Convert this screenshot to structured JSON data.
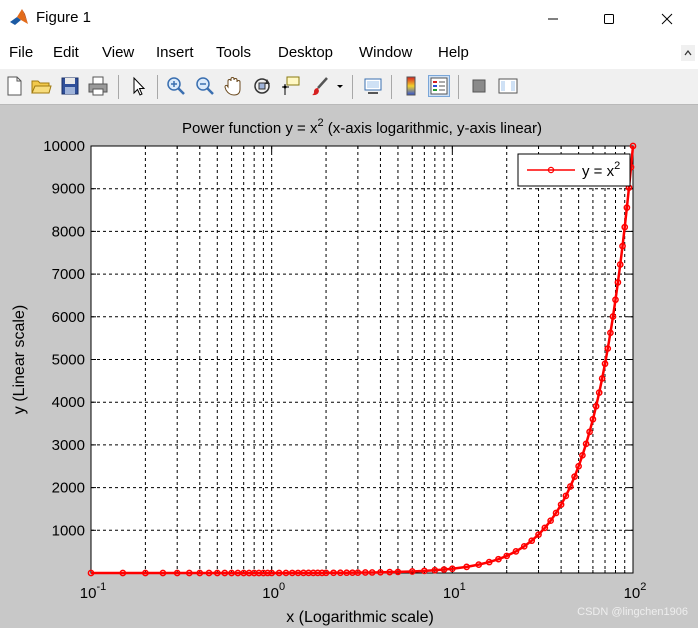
{
  "window": {
    "title": "Figure 1",
    "controls": {
      "minimize": "minimize",
      "maximize": "maximize",
      "close": "close"
    }
  },
  "menu": {
    "items": [
      "File",
      "Edit",
      "View",
      "Insert",
      "Tools",
      "Desktop",
      "Window",
      "Help"
    ]
  },
  "toolbar": {
    "buttons": [
      "new-figure",
      "open-file",
      "save-figure",
      "print-figure",
      "edit-plot",
      "zoom-in",
      "zoom-out",
      "pan",
      "rotate-3d",
      "data-cursor",
      "brush",
      "link-plot",
      "insert-colorbar",
      "insert-legend",
      "hide-plot-tools",
      "show-plot-tools"
    ]
  },
  "colors": {
    "line": "#ff0000",
    "axes_bg": "#ffffff",
    "figure_bg": "#c8c8c8",
    "grid": "#000000"
  },
  "watermark": "CSDN @lingchen1906",
  "chart_data": {
    "type": "line",
    "title": "Power function y = x",
    "title_superscript": "2",
    "title_rest": "  (x-axis logarithmic, y-axis linear)",
    "xlabel": "x (Logarithmic scale)",
    "ylabel": "y (Linear scale)",
    "xscale": "log",
    "yscale": "linear",
    "xlim": [
      0.1,
      100
    ],
    "ylim": [
      0,
      10000
    ],
    "xticks": [
      {
        "value": 0.1,
        "base": "10",
        "exp": "-1"
      },
      {
        "value": 1,
        "base": "10",
        "exp": "0"
      },
      {
        "value": 10,
        "base": "10",
        "exp": "1"
      },
      {
        "value": 100,
        "base": "10",
        "exp": "2"
      }
    ],
    "yticks": [
      1000,
      2000,
      3000,
      4000,
      5000,
      6000,
      7000,
      8000,
      9000,
      10000
    ],
    "ytick_labels": [
      "1000",
      "2000",
      "3000",
      "4000",
      "5000",
      "6000",
      "7000",
      "8000",
      "9000",
      "10000"
    ],
    "grid": true,
    "grid_style": "dashed",
    "legend_position": "top-right",
    "series": [
      {
        "name": "y = x",
        "name_superscript": "2",
        "color": "#ff0000",
        "marker": "circle",
        "formula": "y = x^2",
        "x": [
          0.1,
          0.15,
          0.2,
          0.25,
          0.3,
          0.35,
          0.4,
          0.45,
          0.5,
          0.55,
          0.6,
          0.65,
          0.7,
          0.75,
          0.8,
          0.85,
          0.9,
          0.95,
          1,
          1.1,
          1.2,
          1.3,
          1.4,
          1.5,
          1.6,
          1.7,
          1.8,
          1.9,
          2,
          2.2,
          2.4,
          2.6,
          2.8,
          3,
          3.3,
          3.6,
          4,
          4.5,
          5,
          6,
          7,
          8,
          9,
          10,
          12,
          14,
          16,
          18,
          20,
          22.5,
          25,
          27.5,
          30,
          32.5,
          35,
          37.5,
          40,
          42.5,
          45,
          47.5,
          50,
          52.5,
          55,
          57.5,
          60,
          62.5,
          65,
          67.5,
          70,
          72.5,
          75,
          77.5,
          80,
          82.5,
          85,
          87.5,
          90,
          92.5,
          95,
          97.5,
          100
        ],
        "y": [
          0.01,
          0.0225,
          0.04,
          0.0625,
          0.09,
          0.1225,
          0.16,
          0.2025,
          0.25,
          0.3025,
          0.36,
          0.4225,
          0.49,
          0.5625,
          0.64,
          0.7225,
          0.81,
          0.9025,
          1,
          1.21,
          1.44,
          1.69,
          1.96,
          2.25,
          2.56,
          2.89,
          3.24,
          3.61,
          4,
          4.84,
          5.76,
          6.76,
          7.84,
          9,
          10.89,
          12.96,
          16,
          20.25,
          25,
          36,
          49,
          64,
          81,
          100,
          144,
          196,
          256,
          324,
          400,
          506.25,
          625,
          756.25,
          900,
          1056.25,
          1225,
          1406.25,
          1600,
          1806.25,
          2025,
          2256.25,
          2500,
          2756.25,
          3025,
          3306.25,
          3600,
          3906.25,
          4225,
          4556.25,
          4900,
          5256.25,
          5625,
          6006.25,
          6400,
          6806.25,
          7225,
          7656.25,
          8100,
          8556.25,
          9025,
          9506.25,
          10000
        ]
      }
    ]
  }
}
